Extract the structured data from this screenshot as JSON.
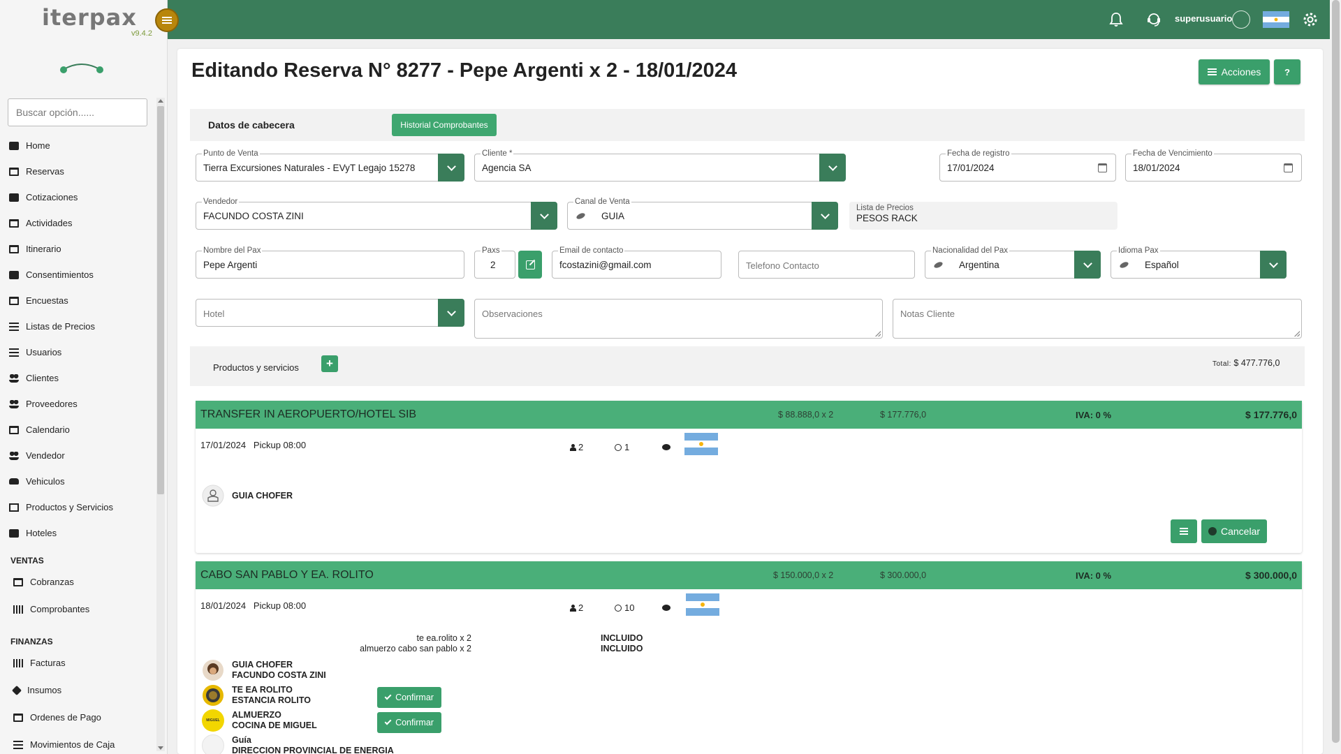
{
  "app": {
    "logo": "iterpax",
    "version": "v9.4.2",
    "user": "superusuario"
  },
  "sidebar": {
    "search_placeholder": "Buscar opción......",
    "items": [
      {
        "label": "Home",
        "icon": "home-icon"
      },
      {
        "label": "Reservas",
        "icon": "calendar-icon"
      },
      {
        "label": "Cotizaciones",
        "icon": "cart-icon"
      },
      {
        "label": "Actividades",
        "icon": "calendar-icon"
      },
      {
        "label": "Itinerario",
        "icon": "calendar-icon"
      },
      {
        "label": "Consentimientos",
        "icon": "book-icon"
      },
      {
        "label": "Encuestas",
        "icon": "edit-icon"
      },
      {
        "label": "Listas de Precios",
        "icon": "list-icon"
      },
      {
        "label": "Usuarios",
        "icon": "list-icon"
      },
      {
        "label": "Clientes",
        "icon": "users-icon"
      },
      {
        "label": "Proveedores",
        "icon": "users-icon"
      },
      {
        "label": "Calendario",
        "icon": "calendar-icon"
      },
      {
        "label": "Vendedor",
        "icon": "users-icon"
      },
      {
        "label": "Vehiculos",
        "icon": "car-icon"
      },
      {
        "label": "Productos y Servicios",
        "icon": "gift-icon"
      },
      {
        "label": "Hoteles",
        "icon": "building-icon"
      }
    ],
    "sections": [
      {
        "title": "VENTAS",
        "items": [
          {
            "label": "Cobranzas",
            "icon": "card-icon"
          },
          {
            "label": "Comprobantes",
            "icon": "barcode-icon"
          }
        ]
      },
      {
        "title": "FINANZAS",
        "items": [
          {
            "label": "Facturas",
            "icon": "barcode-icon"
          },
          {
            "label": "Insumos",
            "icon": "tag-icon"
          },
          {
            "label": "Ordenes de Pago",
            "icon": "money-icon"
          },
          {
            "label": "Movimientos de Caja",
            "icon": "list-icon"
          }
        ]
      }
    ]
  },
  "page": {
    "title": "Editando Reserva N° 8277 - Pepe Argenti x 2 - 18/01/2024",
    "acciones_label": "Acciones",
    "help_label": "?"
  },
  "header": {
    "label": "Datos de cabecera",
    "historial_label": "Historial Comprobantes"
  },
  "form": {
    "punto_venta": {
      "label": "Punto de Venta",
      "value": "Tierra Excursiones Naturales - EVyT Legajo 15278"
    },
    "cliente": {
      "label": "Cliente *",
      "value": "Agencia SA"
    },
    "fecha_registro": {
      "label": "Fecha de registro",
      "value": "17/01/2024"
    },
    "fecha_vencimiento": {
      "label": "Fecha de Vencimiento",
      "value": "18/01/2024"
    },
    "vendedor": {
      "label": "Vendedor",
      "value": "FACUNDO COSTA ZINI"
    },
    "canal_venta": {
      "label": "Canal de Venta",
      "value": "GUIA"
    },
    "lista_precios": {
      "label": "Lista de Precios",
      "value": "PESOS RACK"
    },
    "nombre_pax": {
      "label": "Nombre del Pax",
      "value": "Pepe Argenti"
    },
    "paxs": {
      "label": "Paxs",
      "value": "2"
    },
    "email": {
      "label": "Email de contacto",
      "value": "fcostazini@gmail.com"
    },
    "telefono": {
      "placeholder": "Telefono Contacto"
    },
    "nacionalidad": {
      "label": "Nacionalidad del Pax",
      "value": "Argentina"
    },
    "idioma": {
      "label": "Idioma Pax",
      "value": "Español"
    },
    "hotel": {
      "placeholder": "Hotel"
    },
    "observaciones": {
      "placeholder": "Observaciones"
    },
    "notas_cliente": {
      "placeholder": "Notas Cliente"
    }
  },
  "products": {
    "label": "Productos y servicios",
    "add_label": "+",
    "total_prefix": "Total:",
    "total_value": "$ 477.776,0",
    "items": [
      {
        "title": "TRANSFER IN AEROPUERTO/HOTEL SIB",
        "unit": "$ 88.888,0 x 2",
        "subtotal": "$ 177.776,0",
        "iva": "IVA: 0 %",
        "total": "$ 177.776,0",
        "date": "17/01/2024",
        "pickup": "Pickup 08:00",
        "pax": "2",
        "duration": "1",
        "resources": [
          {
            "role": "GUIA CHOFER",
            "name": ""
          }
        ],
        "cancel_label": "Cancelar"
      },
      {
        "title": "CABO SAN PABLO Y EA. ROLITO",
        "unit": "$ 150.000,0 x 2",
        "subtotal": "$ 300.000,0",
        "iva": "IVA: 0 %",
        "total": "$ 300.000,0",
        "date": "18/01/2024",
        "pickup": "Pickup 08:00",
        "pax": "2",
        "duration": "10",
        "included": [
          {
            "item": "te ea.rolito  x  2",
            "status": "INCLUIDO"
          },
          {
            "item": "almuerzo cabo san pablo  x  2",
            "status": "INCLUIDO"
          }
        ],
        "resources": [
          {
            "role": "GUIA CHOFER",
            "name": "FACUNDO COSTA ZINI"
          },
          {
            "role": "TE EA ROLITO",
            "name": "ESTANCIA ROLITO",
            "confirm_label": "Confirmar"
          },
          {
            "role": "ALMUERZO",
            "name": "COCINA DE MIGUEL",
            "confirm_label": "Confirmar",
            "avatar_text": "MIGUEL"
          },
          {
            "role": "Guía",
            "name": "DIRECCION PROVINCIAL DE ENERGIA"
          }
        ]
      }
    ]
  },
  "colors": {
    "topbar": "#3a7d5a",
    "accent": "#3a9f6b",
    "product_header": "#4aaf79",
    "hamburger": "#b8860b"
  }
}
